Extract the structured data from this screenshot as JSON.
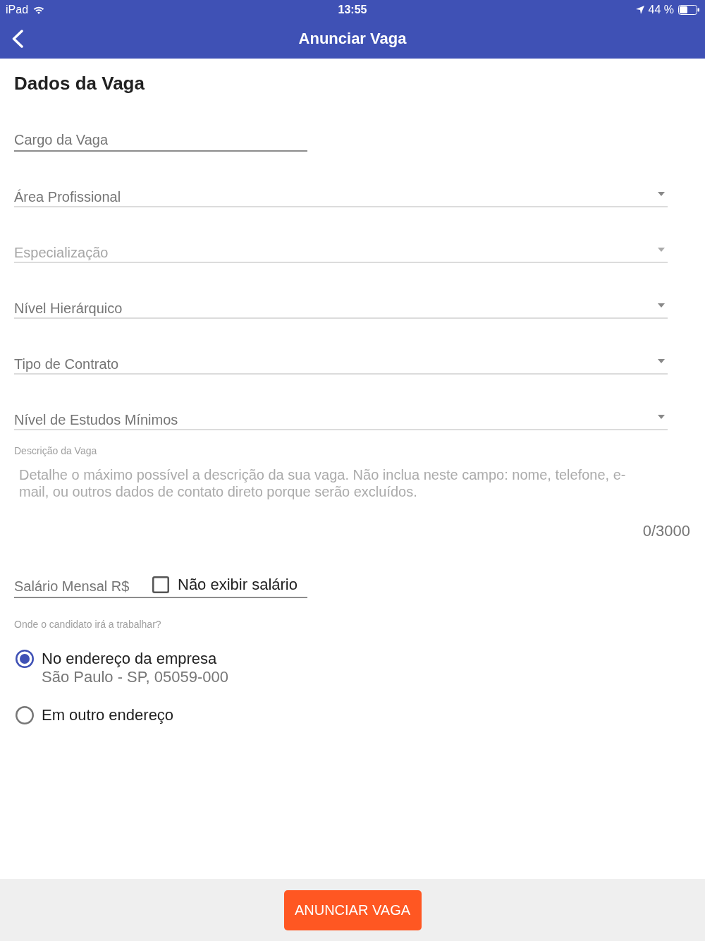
{
  "status_bar": {
    "carrier": "iPad",
    "time": "13:55",
    "battery": "44 %"
  },
  "header": {
    "title": "Anunciar Vaga"
  },
  "section_title": "Dados da Vaga",
  "fields": [
    {
      "kind": "text",
      "placeholder": "Cargo da Vaga",
      "disabled": false
    },
    {
      "kind": "select",
      "placeholder": "Área Profissional",
      "disabled": false
    },
    {
      "kind": "select",
      "placeholder": "Especialização",
      "disabled": true
    },
    {
      "kind": "select",
      "placeholder": "Nível Hierárquico",
      "disabled": false
    },
    {
      "kind": "select",
      "placeholder": "Tipo de Contrato",
      "disabled": false
    },
    {
      "kind": "select",
      "placeholder": "Nível de Estudos Mínimos",
      "disabled": false
    }
  ],
  "description": {
    "label": "Descrição da Vaga",
    "placeholder": "Detalhe o máximo possível a descrição da sua vaga. Não inclua neste campo: nome, telefone, e-mail, ou outros dados de contato direto porque serão excluídos.",
    "counter": "0/3000"
  },
  "salary": {
    "placeholder": "Salário Mensal R$",
    "hide_salary": {
      "label": "Não exibir salário",
      "checked": false
    }
  },
  "work_location": {
    "label": "Onde o candidato irá a trabalhar?",
    "options": [
      {
        "label": "No endereço da empresa",
        "detail": "São Paulo - SP, 05059-000",
        "selected": true
      },
      {
        "label": "Em outro endereço",
        "selected": false
      }
    ]
  },
  "submit_button": "ANUNCIAR VAGA"
}
